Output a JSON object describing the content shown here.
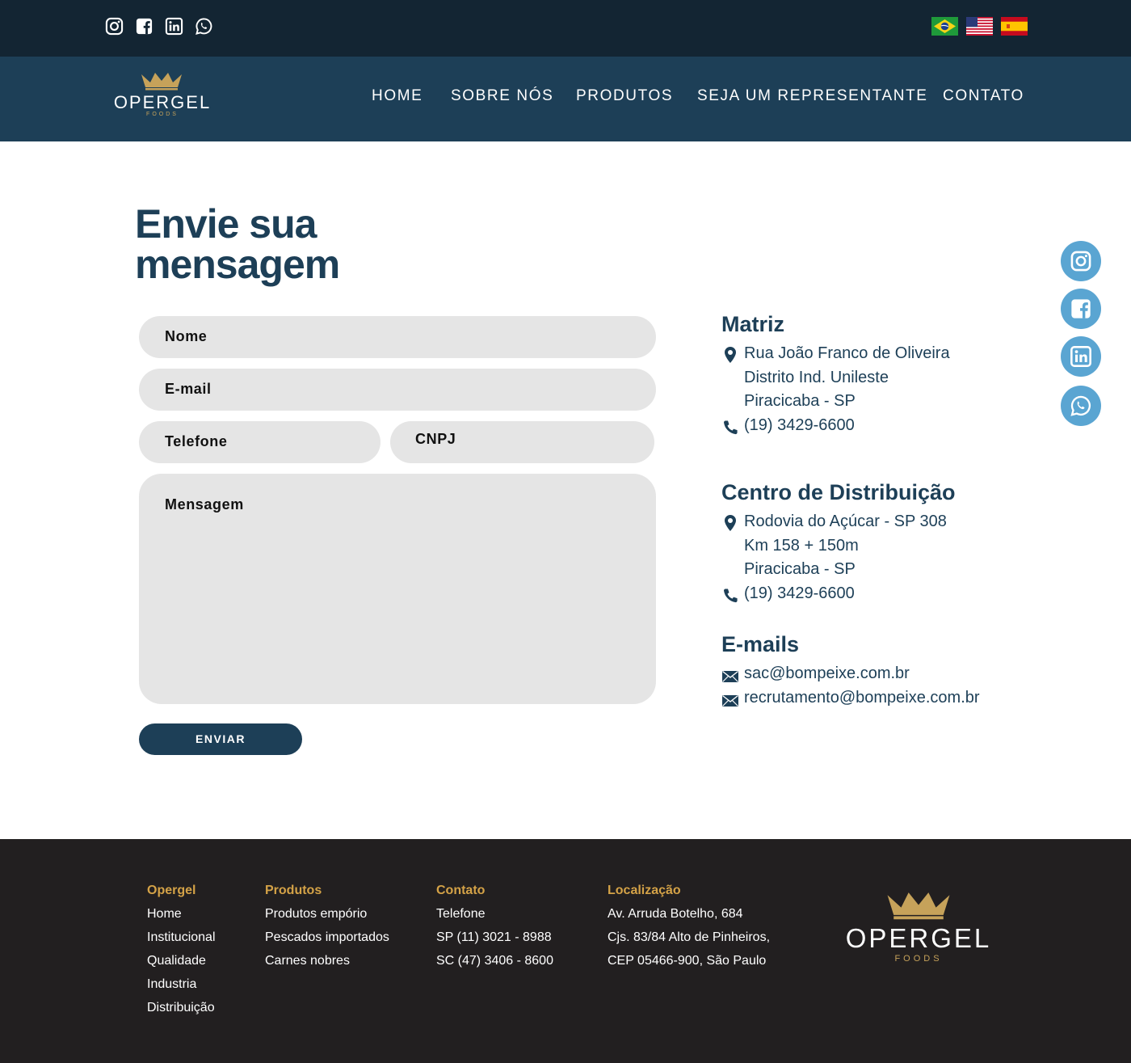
{
  "topbar": {
    "social_icons": [
      "instagram-icon",
      "facebook-icon",
      "linkedin-icon",
      "whatsapp-icon"
    ],
    "languages": [
      "brazil-flag",
      "usa-flag",
      "spain-flag"
    ]
  },
  "brand": {
    "name": "OPERGEL",
    "tagline": "FOODS",
    "gold": "#c6a25a"
  },
  "nav": {
    "items": [
      "HOME",
      "SOBRE NÓS",
      "PRODUTOS",
      "SEJA UM REPRESENTANTE",
      "CONTATO"
    ]
  },
  "form": {
    "title_line1": "Envie sua",
    "title_line2": "mensagem",
    "name_label": "Nome",
    "email_label": "E-mail",
    "phone_label": "Telefone",
    "cnpj_label": "CNPJ",
    "message_label": "Mensagem",
    "submit_label": "ENVIAR"
  },
  "info": {
    "matriz": {
      "title": "Matriz",
      "address": [
        "Rua João Franco de Oliveira",
        "Distrito Ind. Unileste",
        "Piracicaba - SP"
      ],
      "phone": "(19) 3429-6600"
    },
    "distribution": {
      "title": "Centro de Distribuição",
      "address": [
        "Rodovia do Açúcar - SP 308",
        "Km 158 + 150m",
        "Piracicaba - SP"
      ],
      "phone": "(19) 3429-6600"
    },
    "emails": {
      "title": "E-mails",
      "list": [
        "sac@bompeixe.com.br",
        "recrutamento@bompeixe.com.br"
      ]
    }
  },
  "floating_social": [
    "instagram-icon",
    "facebook-icon",
    "linkedin-icon",
    "whatsapp-icon"
  ],
  "footer": {
    "columns": [
      {
        "title": "Opergel",
        "items": [
          "Home",
          "Institucional",
          "Qualidade",
          "Industria",
          "Distribuição"
        ]
      },
      {
        "title": "Produtos",
        "items": [
          "Produtos empório",
          "Pescados importados",
          "Carnes nobres"
        ]
      },
      {
        "title": "Contato",
        "items": [
          "Telefone",
          "SP (11) 3021 - 8988",
          "SC (47) 3406 - 8600"
        ]
      },
      {
        "title": "Localização",
        "items": [
          "Av. Arruda Botelho, 684",
          "Cjs. 83/84 Alto de Pinheiros,",
          "CEP 05466-900, São Paulo"
        ]
      }
    ]
  },
  "colors": {
    "topbar": "#132533",
    "navbar": "#1d3f57",
    "primary": "#1d3f57",
    "field": "#e5e5e5",
    "float_icon": "#5aa5d2",
    "footer": "#221f20",
    "footer_heading": "#d4a247"
  }
}
